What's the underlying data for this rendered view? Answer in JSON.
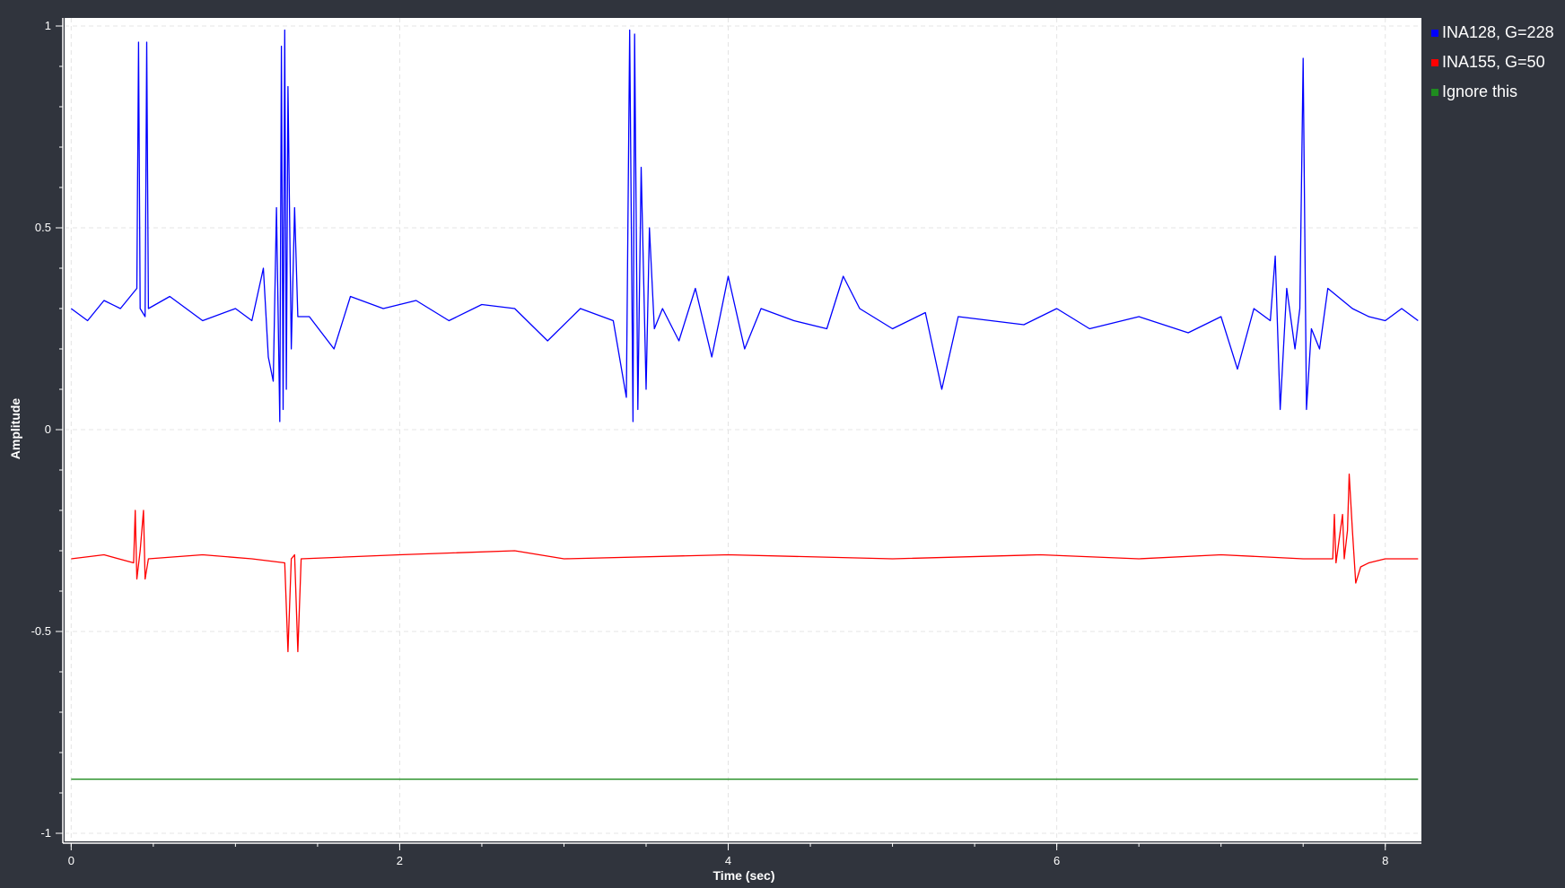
{
  "chart_data": {
    "type": "line",
    "xlabel": "Time (sec)",
    "ylabel": "Amplitude",
    "xlim": [
      -0.04,
      8.22
    ],
    "ylim": [
      -1.02,
      1.02
    ],
    "xticks": [
      {
        "value": 0,
        "label": "0"
      },
      {
        "value": 2,
        "label": "2"
      },
      {
        "value": 4,
        "label": "4"
      },
      {
        "value": 6,
        "label": "6"
      },
      {
        "value": 8,
        "label": "8"
      }
    ],
    "yticks": [
      {
        "value": 1,
        "label": "1"
      },
      {
        "value": 0.5,
        "label": "0.5"
      },
      {
        "value": 0,
        "label": "0"
      },
      {
        "value": -0.5,
        "label": "-0.5"
      },
      {
        "value": -1,
        "label": "-1"
      }
    ],
    "grid": true,
    "legend_position": "right",
    "series": [
      {
        "name": "INA128, G=228",
        "color": "#0000ff",
        "points": [
          [
            0,
            0.3
          ],
          [
            0.1,
            0.27
          ],
          [
            0.2,
            0.32
          ],
          [
            0.3,
            0.3
          ],
          [
            0.4,
            0.35
          ],
          [
            0.41,
            0.96
          ],
          [
            0.42,
            0.3
          ],
          [
            0.45,
            0.28
          ],
          [
            0.46,
            0.96
          ],
          [
            0.47,
            0.3
          ],
          [
            0.6,
            0.33
          ],
          [
            0.8,
            0.27
          ],
          [
            1.0,
            0.3
          ],
          [
            1.1,
            0.27
          ],
          [
            1.17,
            0.4
          ],
          [
            1.2,
            0.18
          ],
          [
            1.23,
            0.12
          ],
          [
            1.25,
            0.55
          ],
          [
            1.27,
            0.02
          ],
          [
            1.28,
            0.95
          ],
          [
            1.29,
            0.05
          ],
          [
            1.3,
            0.99
          ],
          [
            1.31,
            0.1
          ],
          [
            1.32,
            0.85
          ],
          [
            1.34,
            0.2
          ],
          [
            1.36,
            0.55
          ],
          [
            1.38,
            0.28
          ],
          [
            1.45,
            0.28
          ],
          [
            1.6,
            0.2
          ],
          [
            1.7,
            0.33
          ],
          [
            1.9,
            0.3
          ],
          [
            2.1,
            0.32
          ],
          [
            2.3,
            0.27
          ],
          [
            2.5,
            0.31
          ],
          [
            2.7,
            0.3
          ],
          [
            2.9,
            0.22
          ],
          [
            3.1,
            0.3
          ],
          [
            3.3,
            0.27
          ],
          [
            3.38,
            0.08
          ],
          [
            3.4,
            0.99
          ],
          [
            3.42,
            0.02
          ],
          [
            3.43,
            0.98
          ],
          [
            3.45,
            0.05
          ],
          [
            3.47,
            0.65
          ],
          [
            3.5,
            0.1
          ],
          [
            3.52,
            0.5
          ],
          [
            3.55,
            0.25
          ],
          [
            3.6,
            0.3
          ],
          [
            3.7,
            0.22
          ],
          [
            3.8,
            0.35
          ],
          [
            3.9,
            0.18
          ],
          [
            4.0,
            0.38
          ],
          [
            4.1,
            0.2
          ],
          [
            4.2,
            0.3
          ],
          [
            4.4,
            0.27
          ],
          [
            4.6,
            0.25
          ],
          [
            4.7,
            0.38
          ],
          [
            4.8,
            0.3
          ],
          [
            5.0,
            0.25
          ],
          [
            5.2,
            0.29
          ],
          [
            5.3,
            0.1
          ],
          [
            5.4,
            0.28
          ],
          [
            5.6,
            0.27
          ],
          [
            5.8,
            0.26
          ],
          [
            6.0,
            0.3
          ],
          [
            6.2,
            0.25
          ],
          [
            6.5,
            0.28
          ],
          [
            6.8,
            0.24
          ],
          [
            7.0,
            0.28
          ],
          [
            7.1,
            0.15
          ],
          [
            7.2,
            0.3
          ],
          [
            7.3,
            0.27
          ],
          [
            7.33,
            0.43
          ],
          [
            7.36,
            0.05
          ],
          [
            7.4,
            0.35
          ],
          [
            7.45,
            0.2
          ],
          [
            7.48,
            0.3
          ],
          [
            7.5,
            0.92
          ],
          [
            7.52,
            0.05
          ],
          [
            7.55,
            0.25
          ],
          [
            7.6,
            0.2
          ],
          [
            7.65,
            0.35
          ],
          [
            7.8,
            0.3
          ],
          [
            7.9,
            0.28
          ],
          [
            8.0,
            0.27
          ],
          [
            8.1,
            0.3
          ],
          [
            8.2,
            0.27
          ]
        ]
      },
      {
        "name": "INA155, G=50",
        "color": "#ff0000",
        "points": [
          [
            0,
            -0.32
          ],
          [
            0.2,
            -0.31
          ],
          [
            0.38,
            -0.33
          ],
          [
            0.39,
            -0.2
          ],
          [
            0.4,
            -0.37
          ],
          [
            0.42,
            -0.3
          ],
          [
            0.44,
            -0.2
          ],
          [
            0.45,
            -0.37
          ],
          [
            0.47,
            -0.32
          ],
          [
            0.8,
            -0.31
          ],
          [
            1.1,
            -0.32
          ],
          [
            1.3,
            -0.33
          ],
          [
            1.32,
            -0.55
          ],
          [
            1.34,
            -0.32
          ],
          [
            1.36,
            -0.31
          ],
          [
            1.38,
            -0.55
          ],
          [
            1.4,
            -0.32
          ],
          [
            2.0,
            -0.31
          ],
          [
            2.7,
            -0.3
          ],
          [
            3.0,
            -0.32
          ],
          [
            4.0,
            -0.31
          ],
          [
            5.0,
            -0.32
          ],
          [
            5.9,
            -0.31
          ],
          [
            6.5,
            -0.32
          ],
          [
            7.0,
            -0.31
          ],
          [
            7.5,
            -0.32
          ],
          [
            7.68,
            -0.32
          ],
          [
            7.69,
            -0.21
          ],
          [
            7.7,
            -0.33
          ],
          [
            7.74,
            -0.21
          ],
          [
            7.75,
            -0.32
          ],
          [
            7.77,
            -0.25
          ],
          [
            7.78,
            -0.11
          ],
          [
            7.8,
            -0.25
          ],
          [
            7.82,
            -0.38
          ],
          [
            7.85,
            -0.34
          ],
          [
            7.9,
            -0.33
          ],
          [
            8.0,
            -0.32
          ],
          [
            8.2,
            -0.32
          ]
        ]
      },
      {
        "name": "Ignore this",
        "color": "#1f8c1f",
        "points": [
          [
            0,
            -0.866
          ],
          [
            8.2,
            -0.866
          ]
        ]
      }
    ]
  }
}
